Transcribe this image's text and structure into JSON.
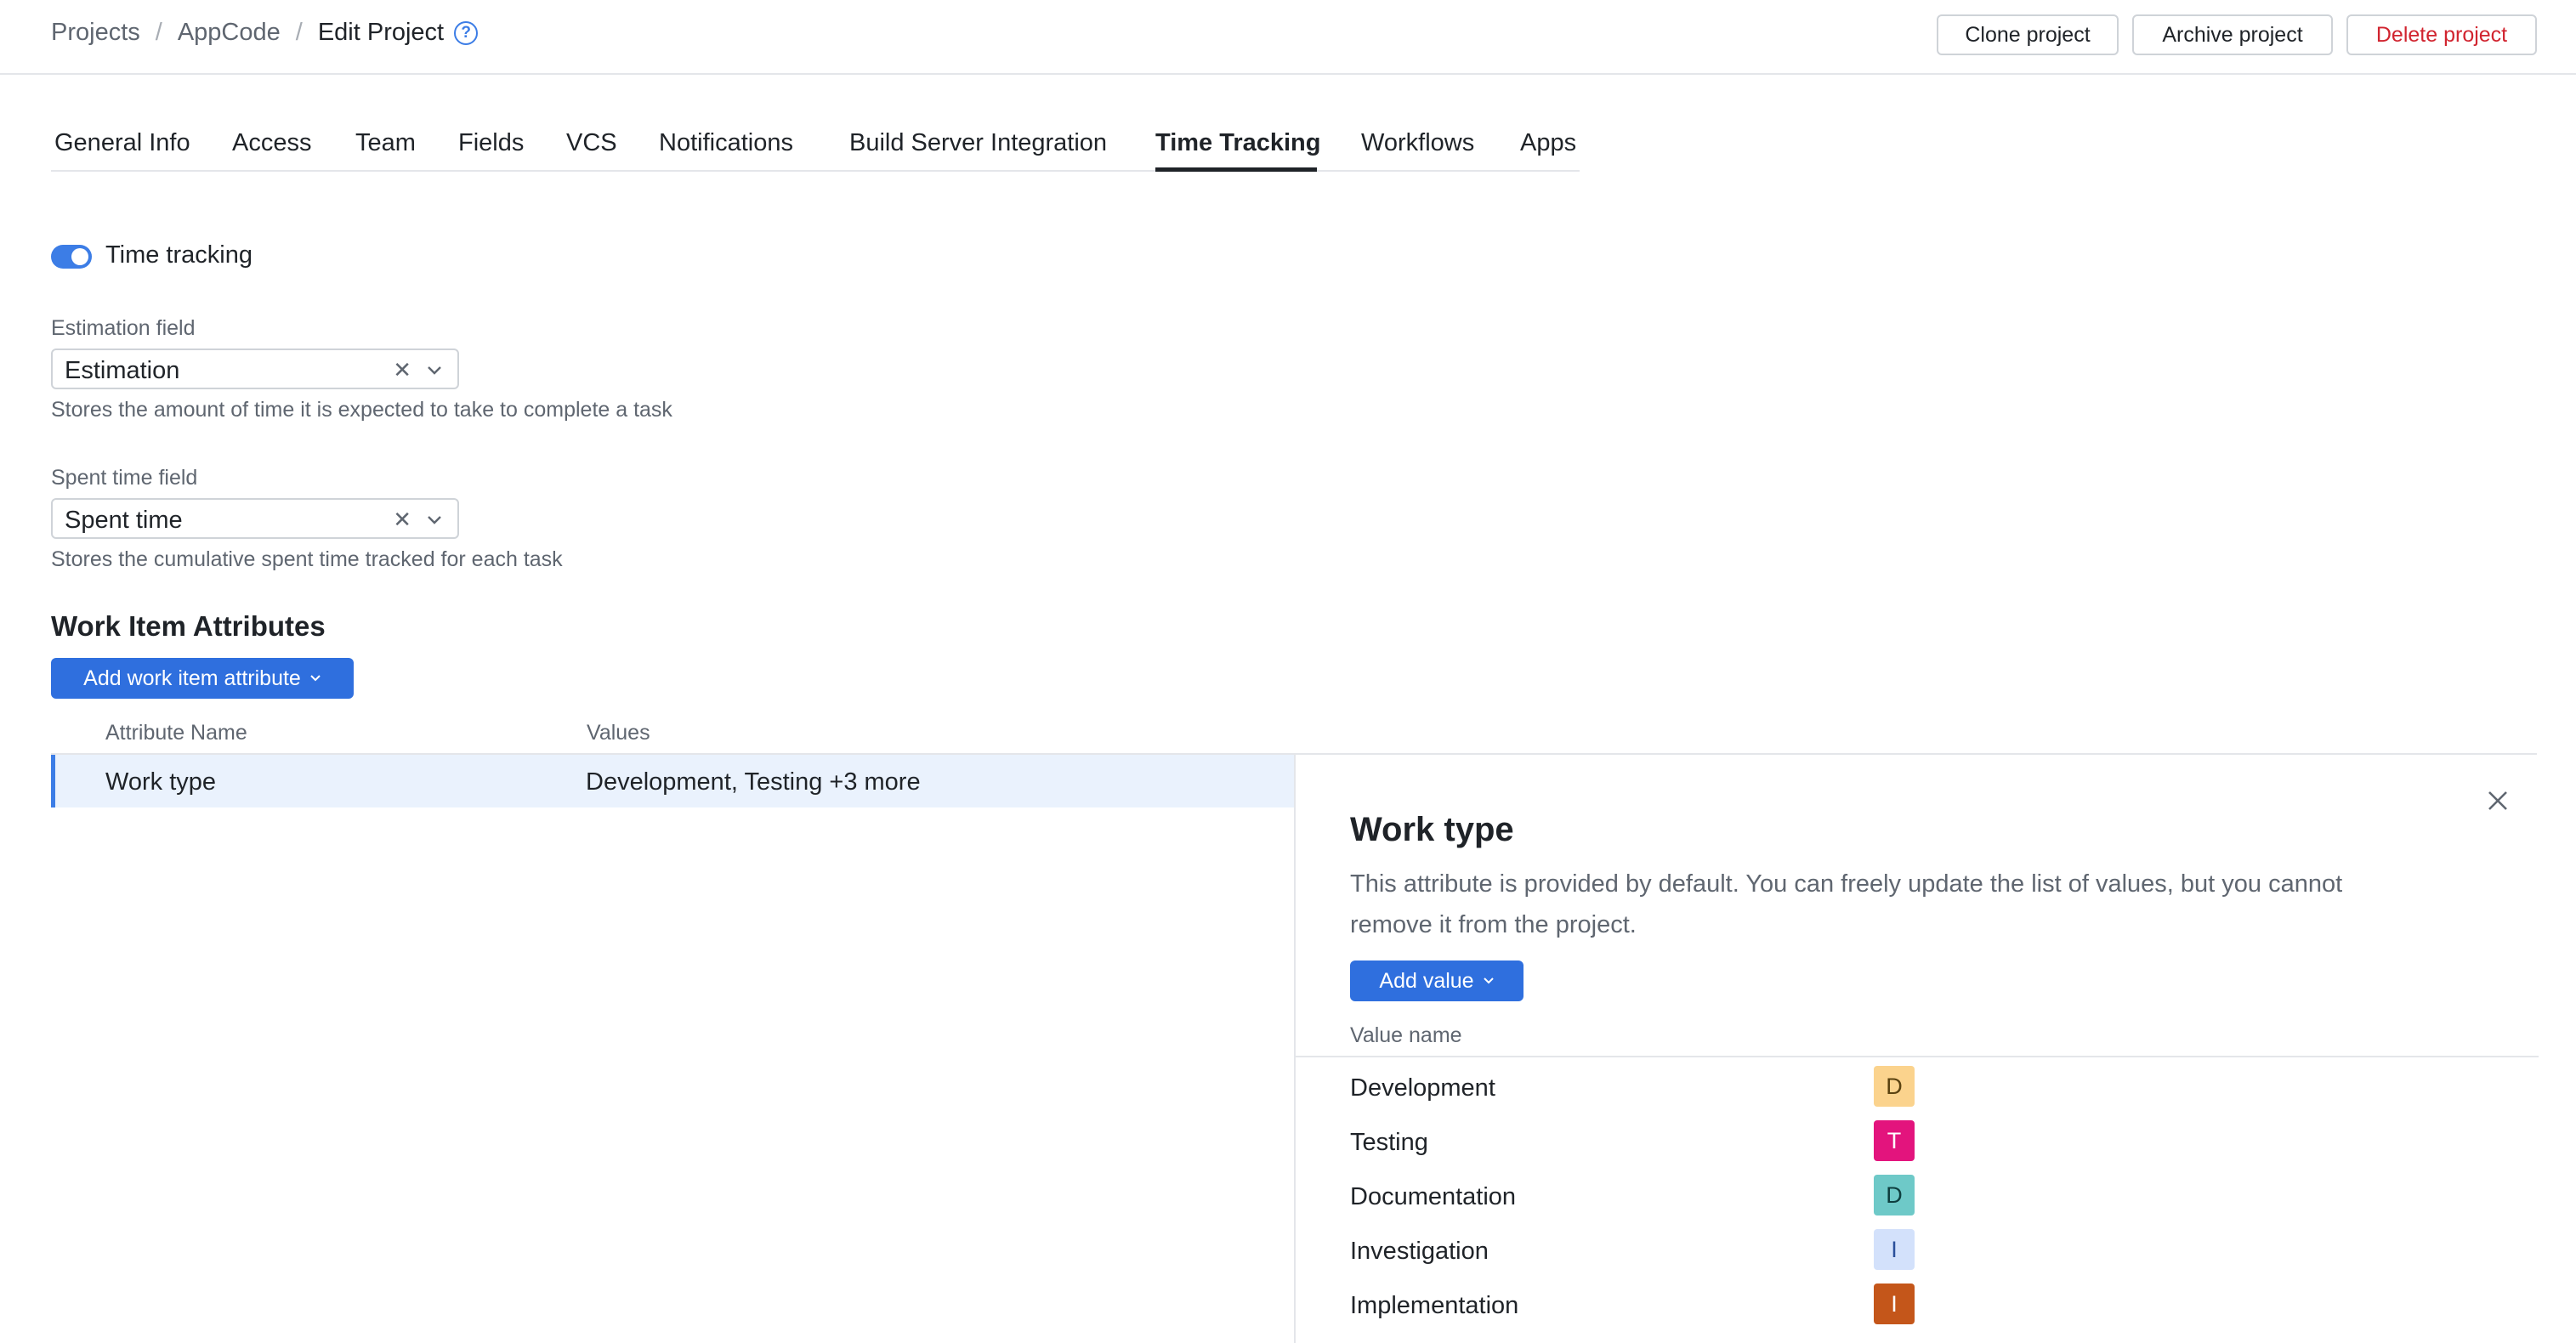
{
  "breadcrumb": {
    "items": [
      "Projects",
      "AppCode"
    ],
    "current": "Edit Project",
    "separator": "/",
    "help_icon": "question-circle-icon",
    "help_glyph": "?"
  },
  "header_actions": {
    "clone": "Clone project",
    "archive": "Archive project",
    "delete": "Delete project"
  },
  "tabs": [
    {
      "label": "General Info"
    },
    {
      "label": "Access"
    },
    {
      "label": "Team"
    },
    {
      "label": "Fields"
    },
    {
      "label": "VCS"
    },
    {
      "label": "Notifications"
    },
    {
      "label": "Build Server Integration"
    },
    {
      "label": "Time Tracking",
      "active": true
    },
    {
      "label": "Workflows"
    },
    {
      "label": "Apps"
    }
  ],
  "time_tracking": {
    "toggle_label": "Time tracking",
    "enabled": true,
    "estimation": {
      "label": "Estimation field",
      "value": "Estimation",
      "hint": "Stores the amount of time it is expected to take to complete a task",
      "clear_glyph": "✕"
    },
    "spent": {
      "label": "Spent time field",
      "value": "Spent time",
      "hint": "Stores the cumulative spent time tracked for each task",
      "clear_glyph": "✕"
    }
  },
  "attributes": {
    "title": "Work Item Attributes",
    "add_button": "Add work item attribute",
    "columns": {
      "name": "Attribute Name",
      "values": "Values"
    },
    "rows": [
      {
        "name": "Work type",
        "values": "Development, Testing +3 more"
      }
    ]
  },
  "panel": {
    "title": "Work type",
    "description": "This attribute is provided by default. You can freely update the list of values, but you cannot remove it from the project.",
    "add_button": "Add value",
    "column": "Value name",
    "values": [
      {
        "name": "Development",
        "letter": "D",
        "bg": "#fbd38d",
        "fg": "#5a4210"
      },
      {
        "name": "Testing",
        "letter": "T",
        "bg": "#e3147d",
        "fg": "#ffffff"
      },
      {
        "name": "Documentation",
        "letter": "D",
        "bg": "#6ec9c8",
        "fg": "#0e3e3e"
      },
      {
        "name": "Investigation",
        "letter": "I",
        "bg": "#d3e1fb",
        "fg": "#2a4f9a"
      },
      {
        "name": "Implementation",
        "letter": "I",
        "bg": "#c4561a",
        "fg": "#ffffff"
      }
    ]
  },
  "colors": {
    "accent": "#2f6fde",
    "danger": "#d1242f"
  }
}
